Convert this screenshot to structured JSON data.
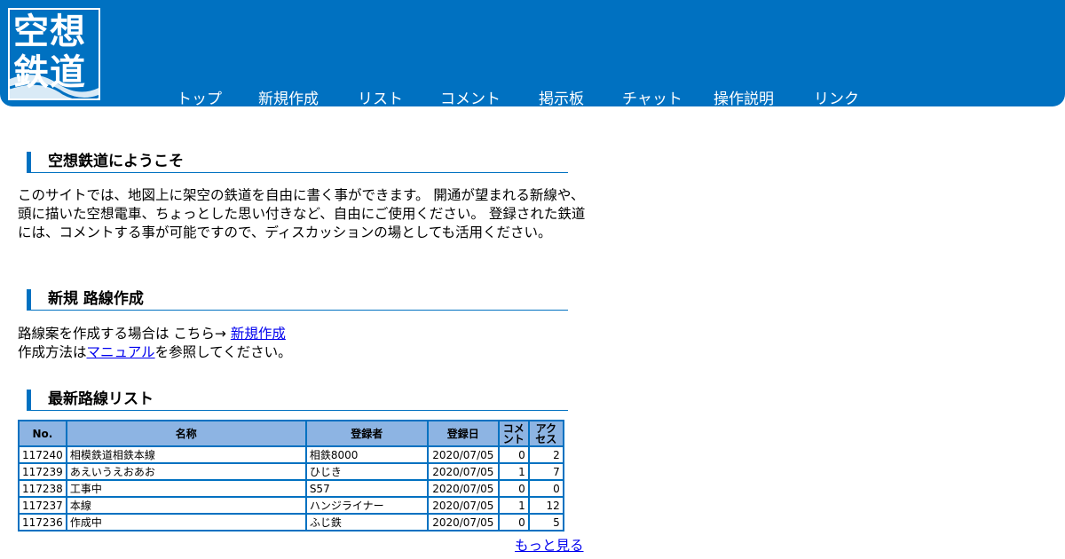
{
  "logo": {
    "line1": "空想",
    "line2": "鉄道"
  },
  "nav": [
    {
      "label": "トップ"
    },
    {
      "label": "新規作成"
    },
    {
      "label": "リスト"
    },
    {
      "label": "コメント"
    },
    {
      "label": "掲示板"
    },
    {
      "label": "チャット"
    },
    {
      "label": "操作説明"
    },
    {
      "label": "リンク"
    }
  ],
  "welcome": {
    "heading": "空想鉄道にようこそ",
    "text": "このサイトでは、地図上に架空の鉄道を自由に書く事ができます。 開通が望まれる新線や、頭に描いた空想電車、ちょっとした思い付きなど、自由にご使用ください。 登録された鉄道には、コメントする事が可能ですので、ディスカッションの場としても活用ください。"
  },
  "create": {
    "heading": "新規 路線作成",
    "line1_text": "路線案を作成する場合は こちら→ ",
    "line1_link": "新規作成",
    "line2_pre": "作成方法は",
    "line2_link": "マニュアル",
    "line2_post": "を参照してください。"
  },
  "latest": {
    "heading": "最新路線リスト",
    "columns": {
      "no": "No.",
      "name": "名称",
      "author": "登録者",
      "date": "登録日",
      "comment": "コメント",
      "access": "アクセス"
    },
    "rows": [
      {
        "no": "117240",
        "name": "相模鉄道相鉄本線",
        "author": "相鉄8000",
        "date": "2020/07/05",
        "comment": "0",
        "access": "2"
      },
      {
        "no": "117239",
        "name": "あえいうえおあお",
        "author": "ひじき",
        "date": "2020/07/05",
        "comment": "1",
        "access": "7"
      },
      {
        "no": "117238",
        "name": "工事中",
        "author": "S57",
        "date": "2020/07/05",
        "comment": "0",
        "access": "0"
      },
      {
        "no": "117237",
        "name": "本線",
        "author": "ハンジライナー",
        "date": "2020/07/05",
        "comment": "1",
        "access": "12"
      },
      {
        "no": "117236",
        "name": "作成中",
        "author": "ふじ鉄",
        "date": "2020/07/05",
        "comment": "0",
        "access": "5"
      }
    ],
    "more": "もっと見る"
  },
  "colors": {
    "brand": "#0071c1",
    "header_cell": "#8db4e3",
    "link": "#0000ee"
  }
}
